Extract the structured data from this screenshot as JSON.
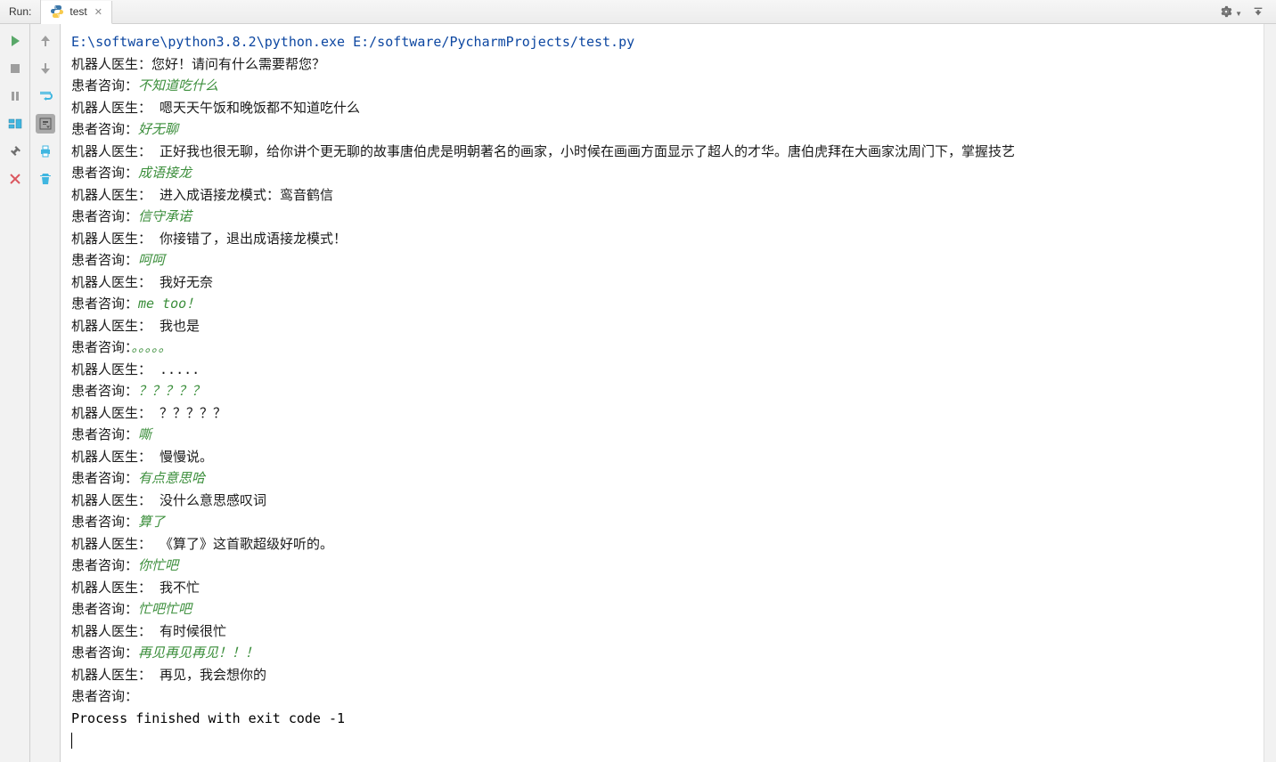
{
  "header": {
    "run_label": "Run:",
    "tab": {
      "label": "test"
    }
  },
  "console": {
    "command": "E:\\software\\python3.8.2\\python.exe E:/software/PycharmProjects/test.py",
    "user_prefix": "患者咨询：",
    "lines": [
      {
        "type": "bot",
        "text": "机器人医生：您好！请问有什么需要帮您？"
      },
      {
        "type": "user",
        "text": "不知道吃什么"
      },
      {
        "type": "bot",
        "text": "机器人医生：  嗯天天午饭和晚饭都不知道吃什么"
      },
      {
        "type": "user",
        "text": "好无聊"
      },
      {
        "type": "bot",
        "text": "机器人医生：  正好我也很无聊，给你讲个更无聊的故事唐伯虎是明朝著名的画家，小时候在画画方面显示了超人的才华。唐伯虎拜在大画家沈周门下，掌握技艺"
      },
      {
        "type": "user",
        "text": "成语接龙"
      },
      {
        "type": "bot",
        "text": "机器人医生：  进入成语接龙模式：鸾音鹤信"
      },
      {
        "type": "user",
        "text": "信守承诺"
      },
      {
        "type": "bot",
        "text": "机器人医生：  你接错了，退出成语接龙模式！"
      },
      {
        "type": "user",
        "text": "呵呵"
      },
      {
        "type": "bot",
        "text": "机器人医生：  我好无奈"
      },
      {
        "type": "user",
        "text": "me too！"
      },
      {
        "type": "bot",
        "text": "机器人医生：  我也是"
      },
      {
        "type": "user",
        "text": "。。。。。"
      },
      {
        "type": "bot",
        "text": "机器人医生：  ....."
      },
      {
        "type": "user",
        "text": "？？？？？"
      },
      {
        "type": "bot",
        "text": "机器人医生：  ？？？？？"
      },
      {
        "type": "user",
        "text": "嘶"
      },
      {
        "type": "bot",
        "text": "机器人医生：  慢慢说。"
      },
      {
        "type": "user",
        "text": "有点意思哈"
      },
      {
        "type": "bot",
        "text": "机器人医生：  没什么意思感叹词"
      },
      {
        "type": "user",
        "text": "算了"
      },
      {
        "type": "bot",
        "text": "机器人医生：  《算了》这首歌超级好听的。"
      },
      {
        "type": "user",
        "text": "你忙吧"
      },
      {
        "type": "bot",
        "text": "机器人医生：  我不忙"
      },
      {
        "type": "user",
        "text": "忙吧忙吧"
      },
      {
        "type": "bot",
        "text": "机器人医生：  有时候很忙"
      },
      {
        "type": "user",
        "text": "再见再见再见！！！"
      },
      {
        "type": "bot",
        "text": "机器人医生：  再见，我会想你的"
      },
      {
        "type": "user",
        "text": ""
      }
    ],
    "exit": "Process finished with exit code -1"
  }
}
